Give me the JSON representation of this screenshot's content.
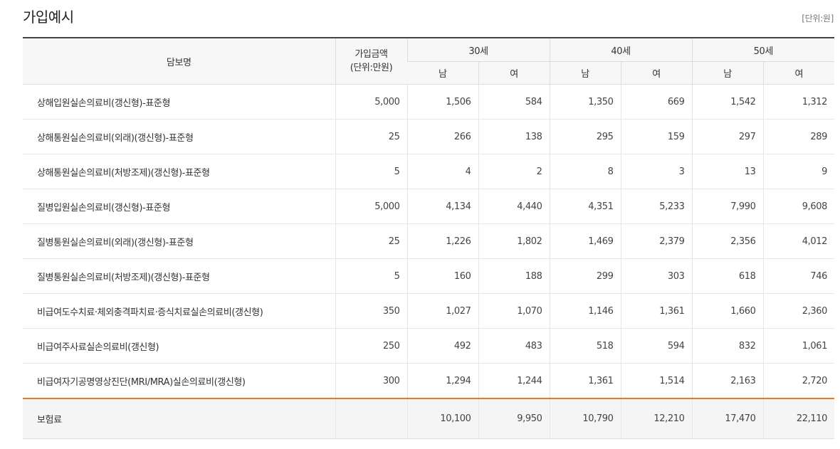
{
  "title": "가입예시",
  "unit": "[단위:원]",
  "headers": {
    "coverage": "담보명",
    "amount_line1": "가입금액",
    "amount_line2": "(단위:만원)",
    "ages": [
      "30세",
      "40세",
      "50세"
    ],
    "male": "남",
    "female": "여"
  },
  "rows": [
    {
      "name": "상해입원실손의료비(갱신형)-표준형",
      "amount": "5,000",
      "values": [
        "1,506",
        "584",
        "1,350",
        "669",
        "1,542",
        "1,312"
      ]
    },
    {
      "name": "상해통원실손의료비(외래)(갱신형)-표준형",
      "amount": "25",
      "values": [
        "266",
        "138",
        "295",
        "159",
        "297",
        "289"
      ]
    },
    {
      "name": "상해통원실손의료비(처방조제)(갱신형)-표준형",
      "amount": "5",
      "values": [
        "4",
        "2",
        "8",
        "3",
        "13",
        "9"
      ]
    },
    {
      "name": "질병입원실손의료비(갱신형)-표준형",
      "amount": "5,000",
      "values": [
        "4,134",
        "4,440",
        "4,351",
        "5,233",
        "7,990",
        "9,608"
      ]
    },
    {
      "name": "질병통원실손의료비(외래)(갱신형)-표준형",
      "amount": "25",
      "values": [
        "1,226",
        "1,802",
        "1,469",
        "2,379",
        "2,356",
        "4,012"
      ]
    },
    {
      "name": "질병통원실손의료비(처방조제)(갱신형)-표준형",
      "amount": "5",
      "values": [
        "160",
        "188",
        "299",
        "303",
        "618",
        "746"
      ]
    },
    {
      "name": "비급여도수치료·체외충격파치료·증식치료실손의료비(갱신형)",
      "amount": "350",
      "values": [
        "1,027",
        "1,070",
        "1,146",
        "1,361",
        "1,660",
        "2,360"
      ]
    },
    {
      "name": "비급여주사료실손의료비(갱신형)",
      "amount": "250",
      "values": [
        "492",
        "483",
        "518",
        "594",
        "832",
        "1,061"
      ]
    },
    {
      "name": "비급여자기공명영상진단(MRI/MRA)실손의료비(갱신형)",
      "amount": "300",
      "values": [
        "1,294",
        "1,244",
        "1,361",
        "1,514",
        "2,163",
        "2,720"
      ]
    }
  ],
  "total": {
    "label": "보험료",
    "amount": "",
    "values": [
      "10,100",
      "9,950",
      "10,790",
      "12,210",
      "17,470",
      "22,110"
    ]
  }
}
